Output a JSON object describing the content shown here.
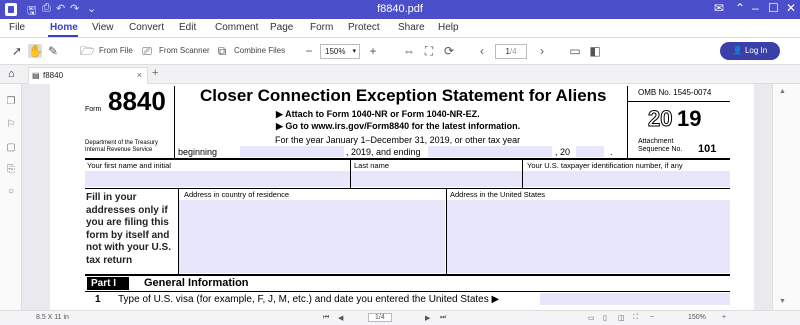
{
  "window": {
    "title": "f8840.pdf"
  },
  "menu": [
    "File",
    "Home",
    "View",
    "Convert",
    "Edit",
    "Comment",
    "Page",
    "Form",
    "Protect",
    "Share",
    "Help"
  ],
  "toolbar": {
    "from_file": "From File",
    "from_scanner": "From Scanner",
    "combine_files": "Combine Files",
    "zoom": "150%",
    "page_field": "1",
    "page_total": "/4",
    "login": "Log In"
  },
  "tab": {
    "name": "f8840"
  },
  "status": {
    "page_size": "8.5 X 11 in",
    "page_indicator": "1",
    "page_total": "/4",
    "zoom": "150%"
  },
  "form": {
    "form_label": "Form",
    "form_number": "8840",
    "dept_line1": "Department of the Treasury",
    "dept_line2": "Internal Revenue Service",
    "title": "Closer Connection Exception Statement for Aliens",
    "attach_line": "▶ Attach to Form 1040-NR or Form 1040-NR-EZ.",
    "goto_line": "▶ Go to www.irs.gov/Form8840 for the latest information.",
    "year_line": "For the year January 1–December 31, 2019, or other tax year",
    "beginning": "beginning",
    "and_ending": ", 2019, and ending",
    "year_suffix": ", 20",
    "period": ".",
    "omb": "OMB No. 1545-0074",
    "tax_year_outline": "20",
    "tax_year_bold": "19",
    "attachment": "Attachment",
    "sequence": "Sequence No.",
    "sequence_no": "101",
    "first_name_label": "Your first name and initial",
    "last_name_label": "Last name",
    "tin_label": "Your U.S. taxpayer identification number, if any",
    "fill_in_text": [
      "Fill in your",
      "addresses only if",
      "you are filing this",
      "form by itself and",
      "not with your U.S.",
      "tax return"
    ],
    "addr_country_label": "Address in country of residence",
    "addr_us_label": "Address in the United States",
    "part_label": "Part I",
    "part_title": "General Information",
    "line1_num": "1",
    "line1_text": "Type of U.S. visa (for example, F, J, M, etc.) and date you entered the United States ▶"
  }
}
